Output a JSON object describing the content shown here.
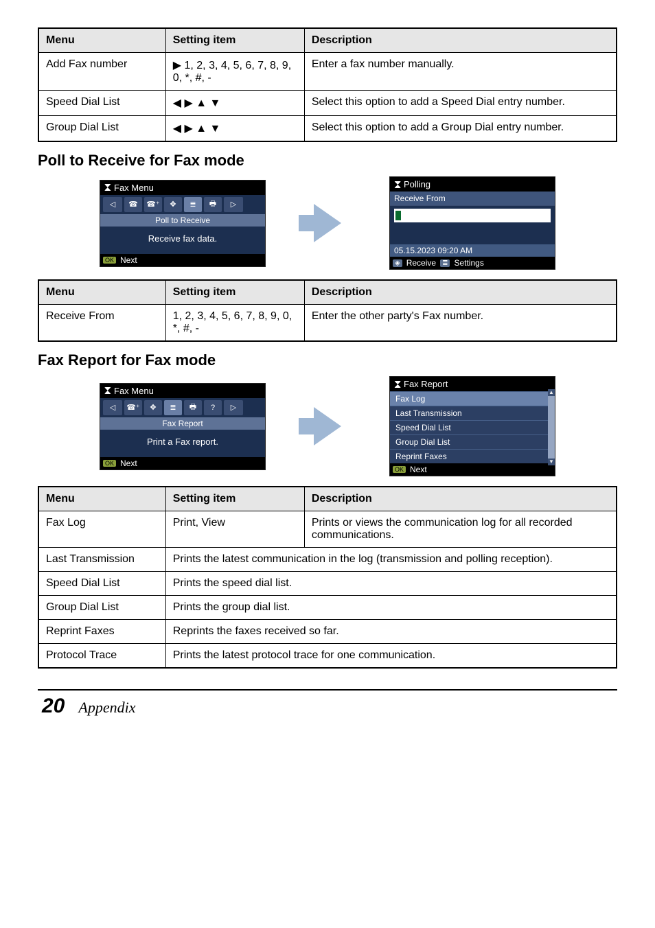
{
  "table1": {
    "headers": {
      "menu": "Menu",
      "setting": "Setting item",
      "desc": "Description"
    },
    "rows": [
      {
        "menu": "Add Fax number",
        "setting": "▶ 1, 2, 3, 4, 5, 6, 7, 8, 9, 0, *, #, -",
        "desc": "Enter a fax number manually."
      },
      {
        "menu": "Speed Dial List",
        "setting": "◀ ▶ ▲ ▼",
        "desc": "Select this option to add a Speed Dial entry number."
      },
      {
        "menu": "Group Dial List",
        "setting": "◀ ▶ ▲ ▼",
        "desc": "Select this option to add a Group Dial entry number."
      }
    ]
  },
  "section1_title": "Poll to Receive for Fax mode",
  "panel1a": {
    "title": "Fax Menu",
    "tab_label": "Poll to Receive",
    "body": "Receive fax data.",
    "foot_key": "OK",
    "foot_text": "Next"
  },
  "panel1b": {
    "title": "Polling",
    "header_line": "Receive From",
    "status": "05.15.2023  09:20 AM",
    "foot_left_icon": "◈",
    "foot_left": "Receive",
    "foot_right_icon": "≣",
    "foot_right": "Settings"
  },
  "table2": {
    "headers": {
      "menu": "Menu",
      "setting": "Setting item",
      "desc": "Description"
    },
    "row": {
      "menu": "Receive From",
      "setting": "1, 2, 3, 4, 5, 6, 7, 8, 9, 0, *, #, -",
      "desc": "Enter the other party's Fax number."
    }
  },
  "section2_title": "Fax Report for Fax mode",
  "panel2a": {
    "title": "Fax Menu",
    "tab_label": "Fax Report",
    "body": "Print a Fax report.",
    "foot_key": "OK",
    "foot_text": "Next"
  },
  "panel2b": {
    "title": "Fax Report",
    "items": [
      "Fax Log",
      "Last Transmission",
      "Speed Dial List",
      "Group Dial List",
      "Reprint Faxes"
    ],
    "foot_key": "OK",
    "foot_text": "Next"
  },
  "table3": {
    "headers": {
      "menu": "Menu",
      "setting": "Setting item",
      "desc": "Description"
    },
    "rows": [
      {
        "menu": "Fax Log",
        "setting": "Print, View",
        "desc": "Prints or views the communication log for all recorded communications."
      },
      {
        "menu": "Last Transmission",
        "span": "Prints the latest communication in the log (transmission and polling reception)."
      },
      {
        "menu": "Speed Dial List",
        "span": "Prints the speed dial list."
      },
      {
        "menu": "Group Dial List",
        "span": "Prints the group dial list."
      },
      {
        "menu": "Reprint Faxes",
        "span": "Reprints the faxes received so far."
      },
      {
        "menu": "Protocol Trace",
        "span": "Prints the latest protocol trace for one communication."
      }
    ]
  },
  "footer": {
    "page": "20",
    "label": "Appendix"
  }
}
